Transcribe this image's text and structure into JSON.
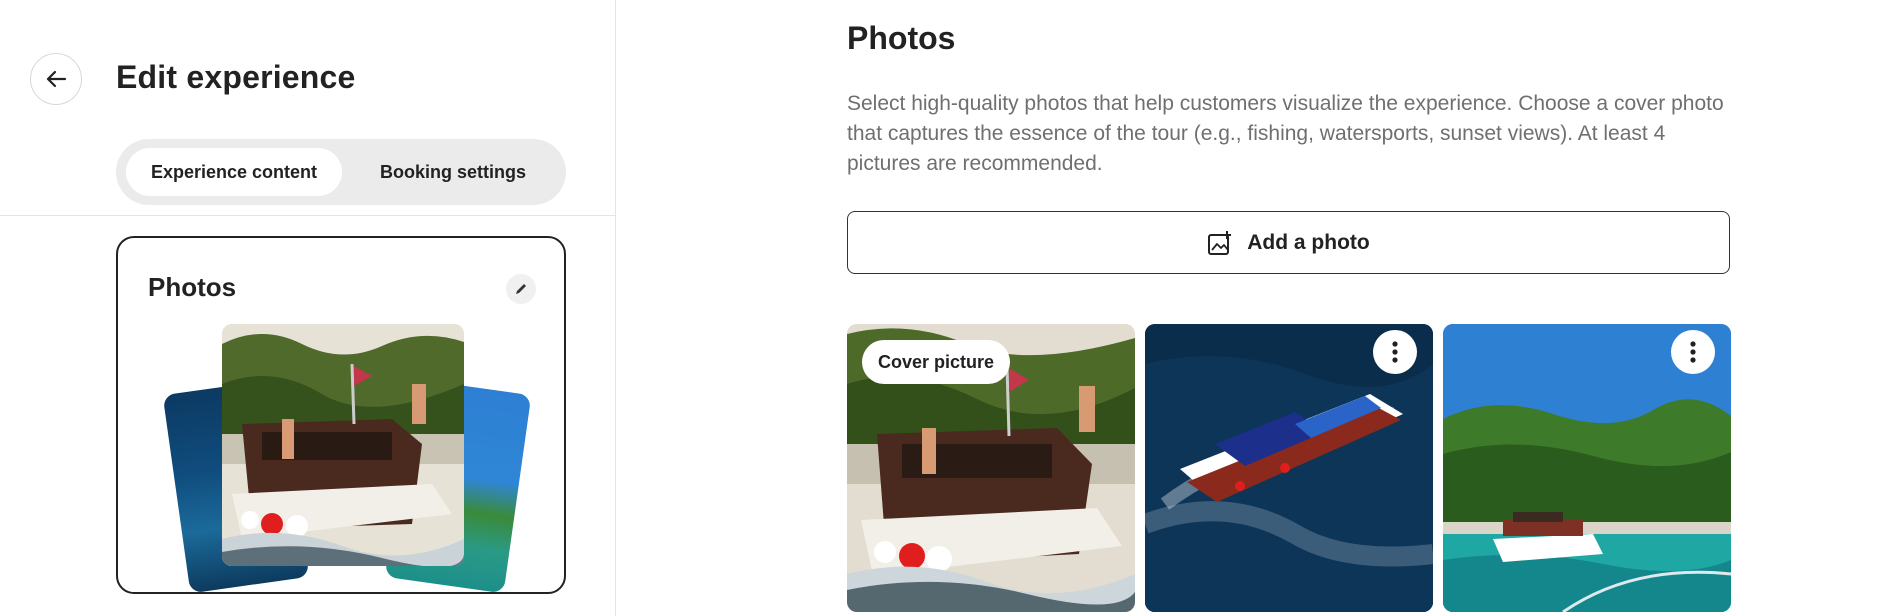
{
  "sidebar": {
    "back_icon": "arrow-left-icon",
    "title": "Edit experience",
    "tabs": [
      {
        "label": "Experience content",
        "active": true
      },
      {
        "label": "Booking settings",
        "active": false
      }
    ],
    "photos_card": {
      "title": "Photos",
      "edit_icon": "pencil-icon"
    }
  },
  "main": {
    "title": "Photos",
    "description": "Select high-quality photos that help customers visualize the experience. Choose a cover photo that captures the essence of the tour (e.g., fishing, watersports, sunset views). At least 4 pictures are recommended.",
    "add_photo": {
      "label": "Add a photo",
      "icon": "add-photo-icon"
    },
    "photos": [
      {
        "name": "photo-cover",
        "badge": "Cover picture"
      },
      {
        "name": "photo-boat-aerial",
        "menu_icon": "more-vertical-icon"
      },
      {
        "name": "photo-boat-bay",
        "menu_icon": "more-vertical-icon"
      }
    ]
  },
  "colors": {
    "text": "#222222",
    "muted": "#6f6f6f",
    "tab_bg": "#ebebeb",
    "border": "#e4e4e4"
  }
}
